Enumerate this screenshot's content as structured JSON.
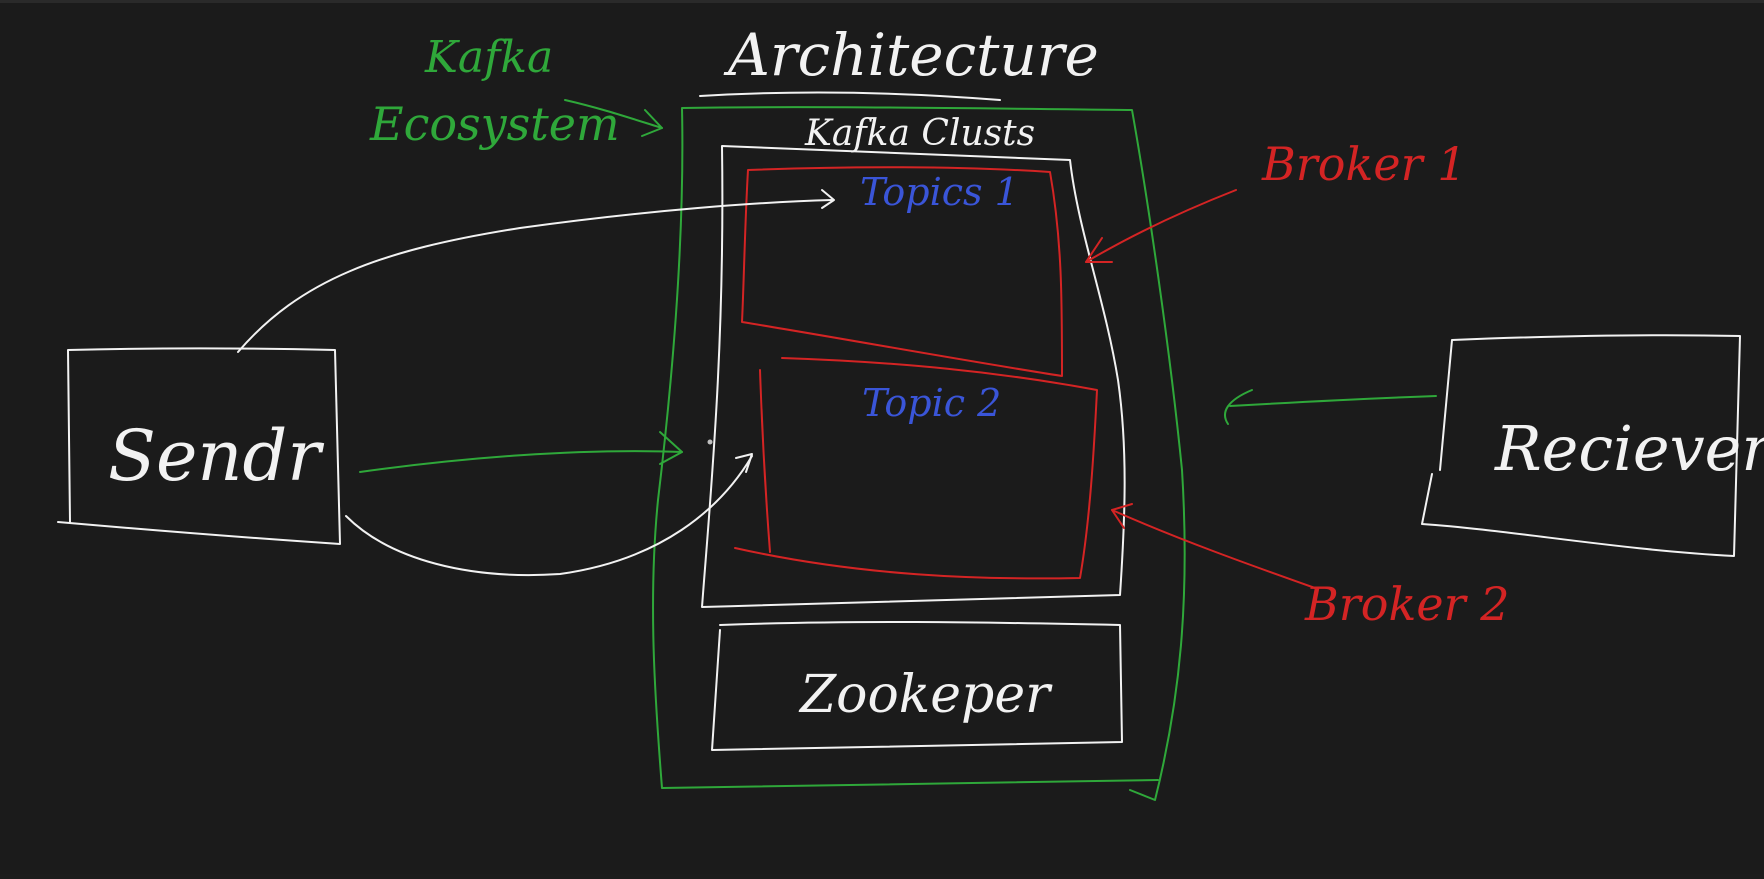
{
  "title": "Architecture",
  "ecosystem_label": [
    "Kafka",
    "Ecosystem"
  ],
  "cluster_label": "Kafka Clusts",
  "topics": [
    "Topics 1",
    "Topic 2"
  ],
  "brokers": [
    "Broker 1",
    "Broker 2"
  ],
  "sender_label": "Sendr",
  "receiver_label": "Reciever",
  "zookeeper_label": "Zookeper",
  "colors": {
    "background": "#1b1b1b",
    "ink_white": "#f2f2f2",
    "ink_green": "#2fa83a",
    "ink_red": "#d42424",
    "ink_blue": "#3a55d8"
  }
}
